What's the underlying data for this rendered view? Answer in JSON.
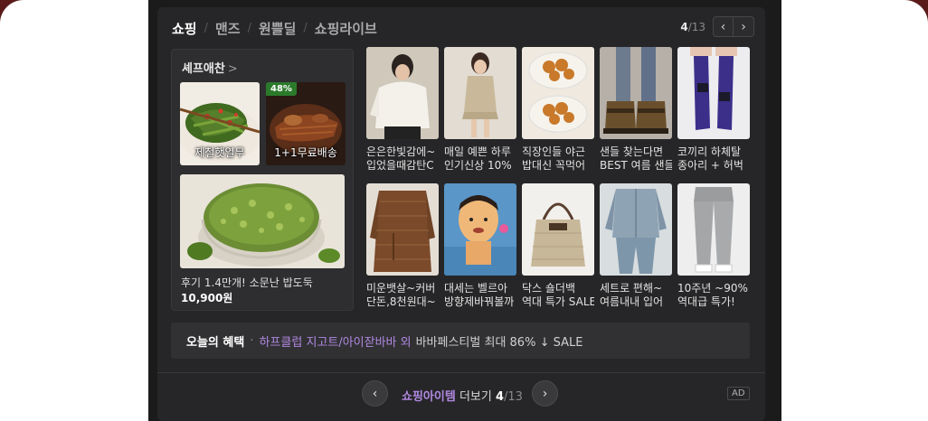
{
  "tabs": [
    {
      "label": "쇼핑",
      "active": true
    },
    {
      "label": "맨즈",
      "active": false
    },
    {
      "label": "원쁠딜",
      "active": false
    },
    {
      "label": "쇼핑라이브",
      "active": false
    }
  ],
  "pager": {
    "current": "4",
    "total": "/13"
  },
  "chef": {
    "title": "셰프애찬",
    "chevron": ">",
    "mini_items": [
      {
        "caption": "제철햇열무",
        "badge": ""
      },
      {
        "caption": "1+1무료배송",
        "badge": "48%"
      }
    ],
    "featured": {
      "title": "후기 1.4만개! 소문난 밥도둑",
      "price": "10,900원"
    }
  },
  "products": [
    {
      "text1": "은은한빛감에~",
      "text2": "입었을때감탄C"
    },
    {
      "text1": "매일 예쁜 하루",
      "text2": "인기신상 10%"
    },
    {
      "text1": "직장인들 야근",
      "text2": "밥대신 꼭먹어"
    },
    {
      "text1": "샌들 찾는다면",
      "text2": "BEST 여름 샌들"
    },
    {
      "text1": "코끼리 하체탈",
      "text2": "종아리 + 허벅"
    },
    {
      "text1": "미운뱃살~커버",
      "text2": "단돈,8천원대~"
    },
    {
      "text1": "대세는 벨르아",
      "text2": "방향제바꿔볼까"
    },
    {
      "text1": "닥스 숄더백",
      "text2": "역대 특가 SALE"
    },
    {
      "text1": "세트로 편해~",
      "text2": "여름내내 입어"
    },
    {
      "text1": "10주년 ~90%",
      "text2": "역대급 특가!"
    }
  ],
  "benefit": {
    "label": "오늘의 혜택",
    "dot": "·",
    "brand": "하프클럽 지고트/아이잗바바 외",
    "rest": "바바페스티벌 최대 86% ↓ SALE"
  },
  "footer": {
    "more_accent": "쇼핑아이템",
    "more_label": "더보기",
    "current": "4",
    "total": "/13",
    "ad": "AD"
  },
  "icons": {
    "prev": "‹",
    "next": "›"
  },
  "colors": {
    "accent": "#b088e0",
    "badge": "#2b7a2b"
  }
}
